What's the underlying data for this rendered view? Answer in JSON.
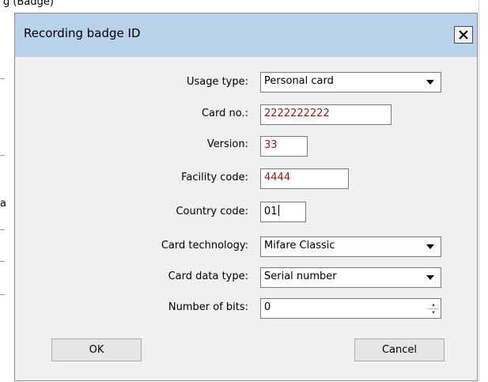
{
  "background": {
    "title_fragment": "g (Badge)",
    "side_letter": "a"
  },
  "dialog": {
    "title": "Recording badge ID",
    "fields": {
      "usage_type": {
        "label": "Usage type:",
        "value": "Personal card"
      },
      "card_no": {
        "label": "Card no.:",
        "value": "2222222222"
      },
      "version": {
        "label": "Version:",
        "value": "33"
      },
      "facility_code": {
        "label": "Facility code:",
        "value": "4444"
      },
      "country_code": {
        "label": "Country code:",
        "value": "01"
      },
      "card_technology": {
        "label": "Card technology:",
        "value": "Mifare Classic"
      },
      "card_data_type": {
        "label": "Card data type:",
        "value": "Serial number"
      },
      "number_of_bits": {
        "label": "Number of bits:",
        "value": "0"
      }
    },
    "buttons": {
      "ok": "OK",
      "cancel": "Cancel"
    }
  },
  "colors": {
    "titlebar": "#b9d1ea",
    "dialog_bg": "#f0f0f0",
    "value_red": "#8b1a1a"
  }
}
